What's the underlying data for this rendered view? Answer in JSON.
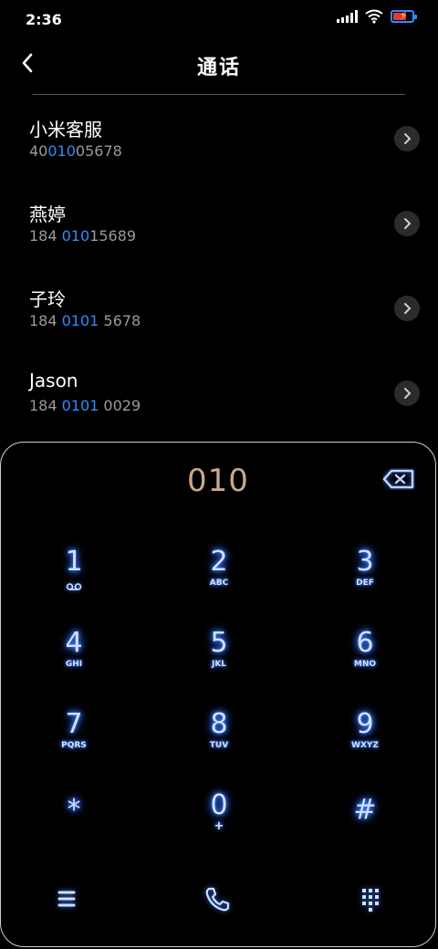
{
  "status": {
    "time": "2:36"
  },
  "header": {
    "title": "通话"
  },
  "contacts": [
    {
      "name": "小米客服",
      "number_pre": "40",
      "number_hl": "010",
      "number_post": "05678"
    },
    {
      "name": "燕婷",
      "number_pre": "184 ",
      "number_hl": "010",
      "number_post": "15689"
    },
    {
      "name": "子玲",
      "number_pre": "184 ",
      "number_hl": "0101",
      "number_post": " 5678"
    },
    {
      "name": "Jason",
      "number_pre": "184 ",
      "number_hl": "0101",
      "number_post": " 0029"
    }
  ],
  "dialer": {
    "input": "010",
    "keys": [
      {
        "digit": "1",
        "letters": ""
      },
      {
        "digit": "2",
        "letters": "ABC"
      },
      {
        "digit": "3",
        "letters": "DEF"
      },
      {
        "digit": "4",
        "letters": "GHI"
      },
      {
        "digit": "5",
        "letters": "JKL"
      },
      {
        "digit": "6",
        "letters": "MNO"
      },
      {
        "digit": "7",
        "letters": "PQRS"
      },
      {
        "digit": "8",
        "letters": "TUV"
      },
      {
        "digit": "9",
        "letters": "WXYZ"
      },
      {
        "digit": "*",
        "letters": ""
      },
      {
        "digit": "0",
        "letters": "+"
      },
      {
        "digit": "#",
        "letters": ""
      }
    ]
  },
  "colors": {
    "accent": "#2f8cff",
    "input_text": "#c8aa86",
    "key_glow": "#3d7cff"
  },
  "icons": {
    "back": "chevron-left-icon",
    "backspace": "backspace-icon",
    "voicemail": "voicemail-icon",
    "menu": "menu-icon",
    "call": "phone-icon",
    "keypad": "keypad-icon"
  }
}
